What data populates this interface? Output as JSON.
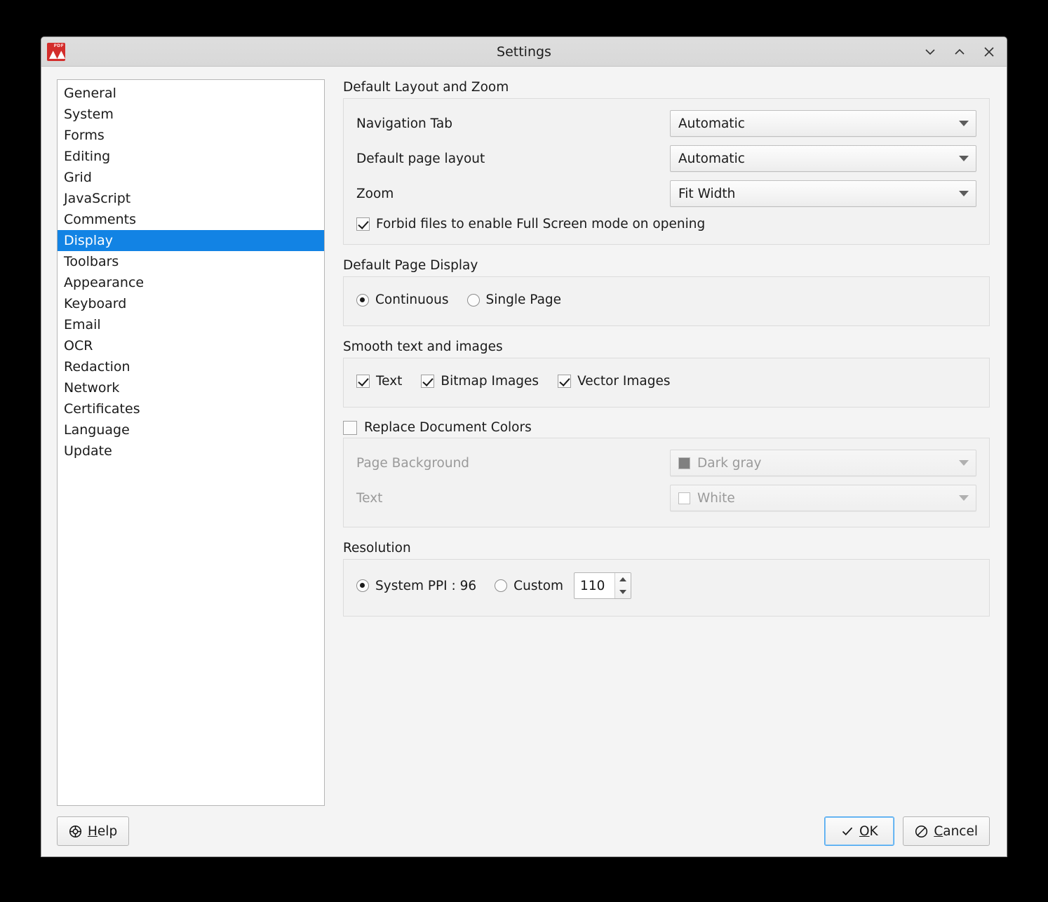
{
  "window": {
    "title": "Settings",
    "app_icon": "pdf-app-icon",
    "app_icon_label": "PDF",
    "controls": [
      {
        "name": "minimize-button",
        "icon": "chevron-down-icon"
      },
      {
        "name": "maximize-button",
        "icon": "chevron-up-icon"
      },
      {
        "name": "close-button",
        "icon": "close-icon"
      }
    ]
  },
  "sidebar": {
    "items": [
      {
        "label": "General",
        "selected": false
      },
      {
        "label": "System",
        "selected": false
      },
      {
        "label": "Forms",
        "selected": false
      },
      {
        "label": "Editing",
        "selected": false
      },
      {
        "label": "Grid",
        "selected": false
      },
      {
        "label": "JavaScript",
        "selected": false
      },
      {
        "label": "Comments",
        "selected": false
      },
      {
        "label": "Display",
        "selected": true
      },
      {
        "label": "Toolbars",
        "selected": false
      },
      {
        "label": "Appearance",
        "selected": false
      },
      {
        "label": "Keyboard",
        "selected": false
      },
      {
        "label": "Email",
        "selected": false
      },
      {
        "label": "OCR",
        "selected": false
      },
      {
        "label": "Redaction",
        "selected": false
      },
      {
        "label": "Network",
        "selected": false
      },
      {
        "label": "Certificates",
        "selected": false
      },
      {
        "label": "Language",
        "selected": false
      },
      {
        "label": "Update",
        "selected": false
      }
    ],
    "selected_color": "#1283e4"
  },
  "layout_zoom": {
    "title": "Default Layout and Zoom",
    "navigation_tab_label": "Navigation Tab",
    "navigation_tab_value": "Automatic",
    "page_layout_label": "Default page layout",
    "page_layout_value": "Automatic",
    "zoom_label": "Zoom",
    "zoom_value": "Fit Width",
    "fullscreen_label": "Forbid files to enable Full Screen mode on opening",
    "fullscreen_checked": true
  },
  "page_display": {
    "title": "Default Page Display",
    "continuous_label": "Continuous",
    "single_page_label": "Single Page",
    "selected": "Continuous"
  },
  "smoothing": {
    "title": "Smooth text and images",
    "options": [
      {
        "label": "Text",
        "checked": true
      },
      {
        "label": "Bitmap Images",
        "checked": true
      },
      {
        "label": "Vector Images",
        "checked": true
      }
    ]
  },
  "replace_colors": {
    "title": "Replace Document Colors",
    "enabled": false,
    "page_background_label": "Page Background",
    "page_background_value": "Dark gray",
    "page_background_swatch": "#808080",
    "text_label": "Text",
    "text_value": "White",
    "text_swatch": "#ffffff"
  },
  "resolution": {
    "title": "Resolution",
    "system_ppi_label": "System PPI : 96",
    "custom_label": "Custom",
    "custom_value": "110",
    "selected": "System PPI : 96"
  },
  "footer": {
    "help_label": "Help",
    "help_accel": "H",
    "help_rest": "elp",
    "ok_label": "OK",
    "ok_accel": "O",
    "ok_rest": "K",
    "cancel_label": "Cancel",
    "cancel_accel": "C",
    "cancel_rest": "ancel"
  }
}
